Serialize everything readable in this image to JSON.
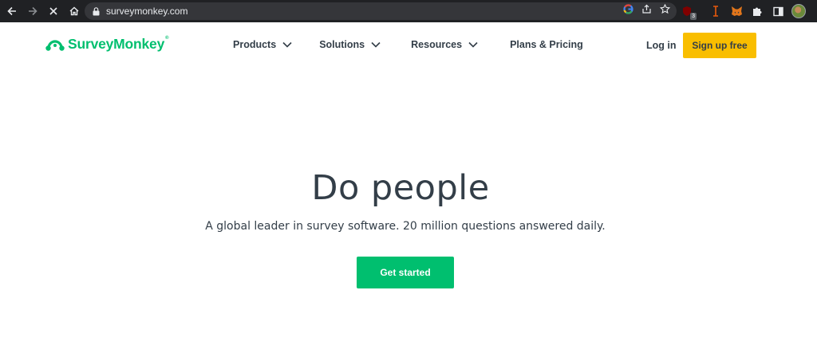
{
  "browser": {
    "url": "surveymonkey.com",
    "extension_badge_count": "3",
    "colors": {
      "chrome_bg": "#202124",
      "omnibox_bg": "#35363a"
    },
    "icons": [
      "back-arrow-icon",
      "forward-arrow-icon",
      "stop-loading-icon",
      "home-icon",
      "lock-icon",
      "google-icon",
      "share-icon",
      "bookmark-star-icon",
      "ublock-icon",
      "cursor-extension-icon",
      "metamask-icon",
      "puzzle-extensions-icon",
      "sidebar-icon",
      "profile-avatar",
      "kebab-menu-icon"
    ]
  },
  "header": {
    "logo_text": "SurveyMonkey",
    "logo_mark": "®",
    "nav": {
      "products": "Products",
      "solutions": "Solutions",
      "resources": "Resources",
      "pricing": "Plans & Pricing"
    },
    "login": "Log in",
    "signup": "Sign up free"
  },
  "hero": {
    "title": "Do people",
    "subtitle": "A global leader in survey software. 20 million questions answered daily.",
    "cta": "Get started"
  },
  "colors": {
    "brand_green": "#00bf6f",
    "signup_yellow": "#f9be00",
    "text_dark": "#333e48"
  }
}
